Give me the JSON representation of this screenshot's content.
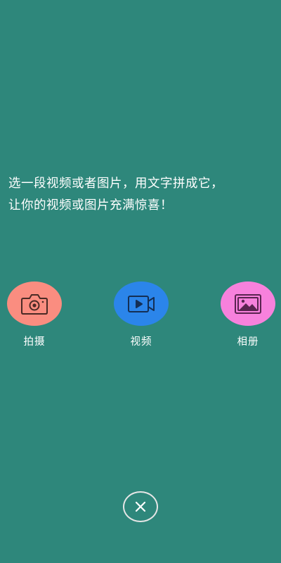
{
  "intro": {
    "line1": "选一段视频或者图片，用文字拼成它，",
    "line2": "让你的视频或图片充满惊喜！"
  },
  "options": {
    "camera": {
      "label": "拍摄",
      "icon": "camera-icon",
      "color": "#fa8d80"
    },
    "video": {
      "label": "视频",
      "icon": "video-camera-icon",
      "color": "#2b85ea"
    },
    "album": {
      "label": "相册",
      "icon": "image-gallery-icon",
      "color": "#f781dc"
    }
  },
  "close": {
    "icon": "close-icon"
  },
  "colors": {
    "background": "#2e877b",
    "text": "#ffffff"
  }
}
